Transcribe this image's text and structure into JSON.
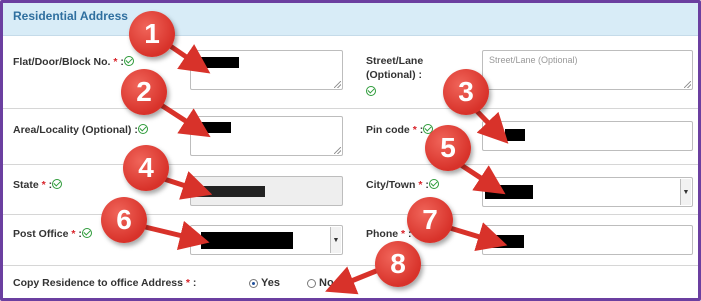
{
  "section": {
    "title": "Residential Address"
  },
  "fields": {
    "flat": {
      "label": "Flat/Door/Block No.",
      "required_mark": "*",
      "sep": ":"
    },
    "street": {
      "label_line1": "Street/Lane",
      "label_line2": "(Optional) :",
      "placeholder": "Street/Lane (Optional)"
    },
    "area": {
      "label": "Area/Locality (Optional) :"
    },
    "pin": {
      "label": "Pin code",
      "required_mark": "*",
      "sep": ":"
    },
    "state": {
      "label": "State",
      "required_mark": "*",
      "sep": ":"
    },
    "city": {
      "label": "City/Town",
      "required_mark": "*",
      "sep": ":"
    },
    "post_office": {
      "label": "Post Office",
      "required_mark": "*",
      "sep": ":"
    },
    "phone": {
      "label": "Phone",
      "required_mark": "*",
      "sep": ":"
    }
  },
  "copy_address": {
    "label": "Copy Residence to office Address",
    "required_mark": "*",
    "sep": ":",
    "options": [
      {
        "label": "Yes",
        "selected": true
      },
      {
        "label": "No",
        "selected": false
      }
    ]
  },
  "annotations": [
    "1",
    "2",
    "3",
    "4",
    "5",
    "6",
    "7",
    "8"
  ],
  "colors": {
    "header_bg": "#d8ecf7",
    "header_text": "#2f6f9f",
    "required": "#d8232a",
    "check": "#2e9b3a",
    "badge": "#d8322a",
    "frame": "#6b3fa0"
  },
  "icons": {
    "valid": "check-circle-icon",
    "dropdown": "dropdown-arrow-icon"
  }
}
